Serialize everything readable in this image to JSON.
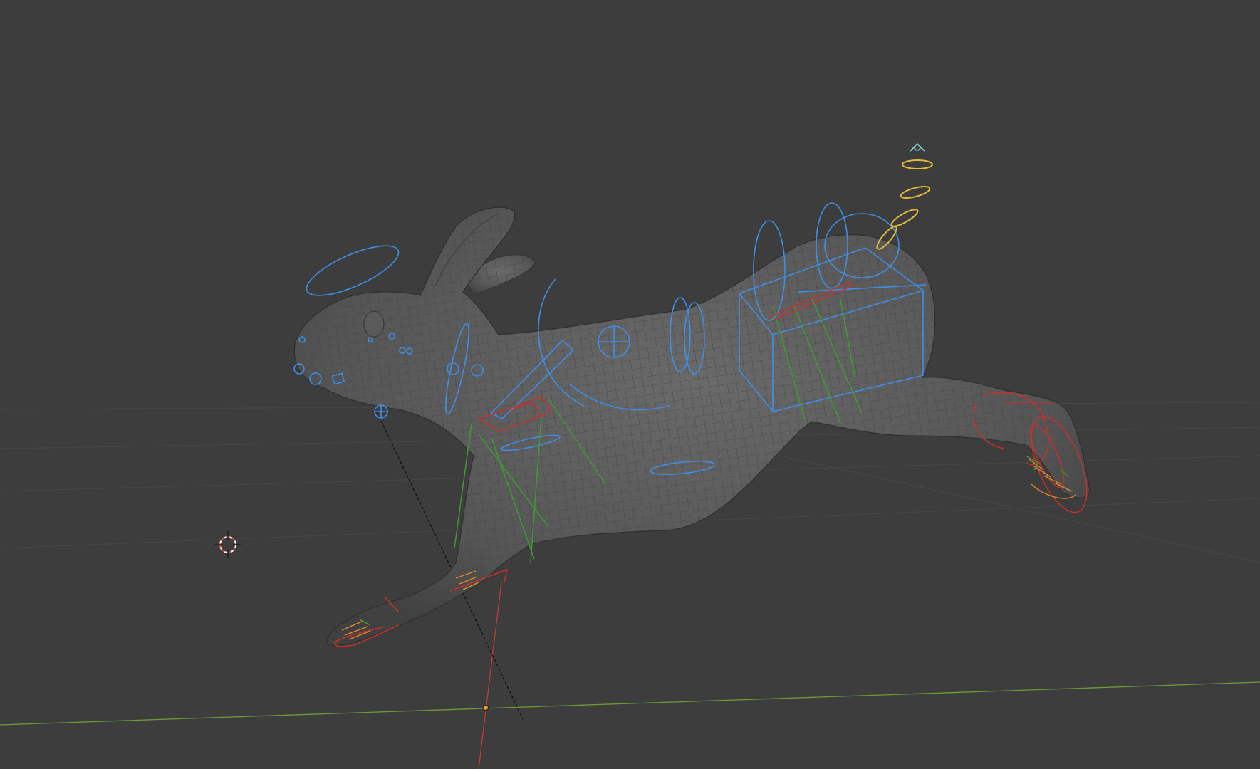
{
  "viewport": {
    "mode": "3D Viewport",
    "colors": {
      "background": "#3d3d3d",
      "grid": "#4a4a4a",
      "x_axis": "#c23a36",
      "y_axis": "#6f9a3a",
      "mesh": "#575757",
      "controls_primary": "#3f8ee6",
      "controls_left": "#c8302c",
      "controls_fk": "#3f9a34",
      "controls_tail": "#e2b93a"
    },
    "objects": [
      {
        "name": "rabbit-mesh",
        "type": "mesh"
      },
      {
        "name": "rabbit-rig",
        "type": "armature"
      }
    ],
    "icons": [
      "3d-cursor-icon",
      "origin-point-icon"
    ]
  }
}
